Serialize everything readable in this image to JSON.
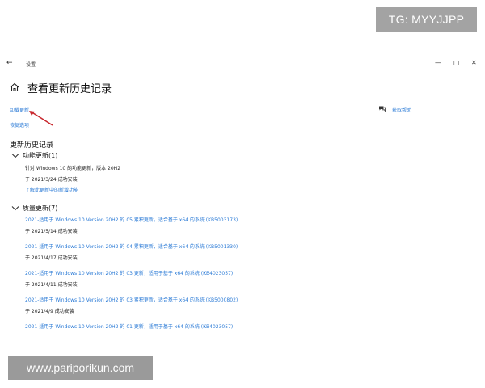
{
  "watermarks": {
    "top": "TG: MYYJJPP",
    "bottom": "www.pariporikun.com"
  },
  "window": {
    "title": "设置",
    "back_icon": "arrow-left-icon",
    "minimize": "—",
    "maximize": "□",
    "close": "✕"
  },
  "header": {
    "home_icon": "home-icon",
    "title": "查看更新历史记录"
  },
  "links": {
    "uninstall": "卸载更新",
    "recovery": "恢复选项",
    "help": "获取帮助",
    "help_icon": "help-chat-icon"
  },
  "section_title": "更新历史记录",
  "feature_updates": {
    "label": "功能更新(1)",
    "items": [
      {
        "name": "针对 Windows 10 的功能更新，版本 20H2",
        "status": "于 2021/3/24 成功安装",
        "extra_link": "了解此更新中的新增功能"
      }
    ]
  },
  "quality_updates": {
    "label": "质量更新(7)",
    "items": [
      {
        "name": "2021-适用于 Windows 10 Version 20H2 的 05 累积更新，适合基于 x64 的系统 (KB5003173)",
        "status": "于 2021/5/14 成功安装"
      },
      {
        "name": "2021-适用于 Windows 10 Version 20H2 的 04 累积更新，适合基于 x64 的系统 (KB5001330)",
        "status": "于 2021/4/17 成功安装"
      },
      {
        "name": "2021-适用于 Windows 10 Version 20H2 的 03 更新，适用于基于 x64 的系统 (KB4023057)",
        "status": "于 2021/4/11 成功安装"
      },
      {
        "name": "2021-适用于 Windows 10 Version 20H2 的 03 累积更新，适合基于 x64 的系统 (KB5000802)",
        "status": "于 2021/4/9 成功安装"
      },
      {
        "name": "2021-适用于 Windows 10 Version 20H2 的 01 更新，适用于基于 x64 的系统 (KB4023057)",
        "status": ""
      }
    ]
  },
  "colors": {
    "link": "#2a7ad6",
    "arrow": "#c8292f",
    "text": "#1a1a1a"
  }
}
